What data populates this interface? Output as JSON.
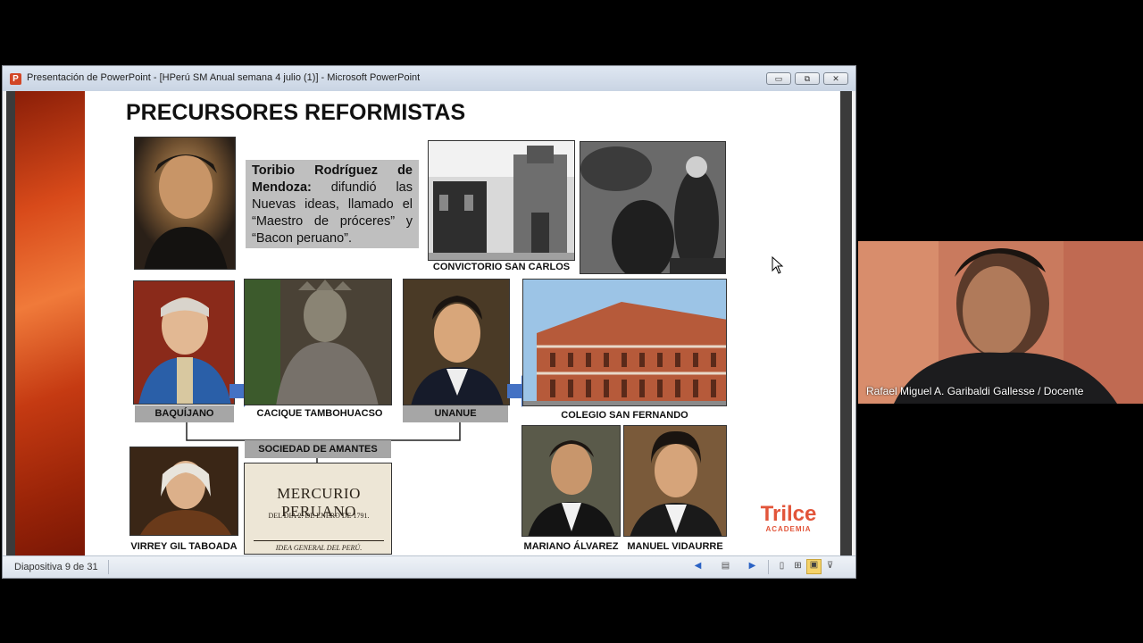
{
  "window": {
    "title": "Presentación de PowerPoint - [HPerú SM Anual semana 4 julio (1)] - Microsoft PowerPoint",
    "app_icon_letter": "P",
    "buttons": {
      "minimize": "▭",
      "restore": "⧉",
      "close": "✕"
    }
  },
  "slide": {
    "title": "PRECURSORES REFORMISTAS",
    "info_box": {
      "name": "Toribio Rodríguez de Mendoza:",
      "text": " difundió las Nuevas ideas, llamado el “Maestro de próceres” y “Bacon peruano”."
    },
    "captions": {
      "convictorio": "CONVICTORIO  SAN CARLOS",
      "baquijano": "BAQUÍJANO",
      "tambohuacso": "CACIQUE  TAMBOHUACSO",
      "unanue": "UNANUE",
      "fernando": "COLEGIO  SAN FERNANDO",
      "sociedad": "SOCIEDAD  DE AMANTES",
      "taboada": "VIRREY  GIL TABOADA",
      "alvarez": "MARIANO  ÁLVAREZ",
      "vidaurre": "MANUEL  VIDAURRE"
    },
    "mercurio": {
      "line1": "MERCURIO PERUANO",
      "line2": "DEL DIA 2. DE ENERO DE 1791.",
      "line3": "IDEA GENERAL DEL PERÚ."
    },
    "logo": {
      "name": "Trilce",
      "sub": "ACADEMIA",
      "color": "#e2553a"
    }
  },
  "status": {
    "slide_counter": "Diapositiva 9 de 31"
  },
  "webcam": {
    "name": "Rafael Miguel A. Garibaldi Gallesse / Docente"
  }
}
